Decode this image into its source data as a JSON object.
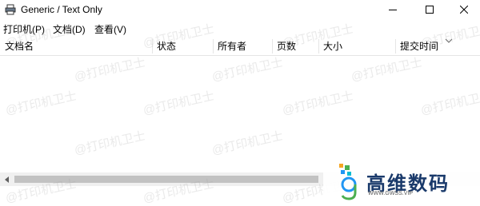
{
  "window": {
    "title": "Generic / Text Only"
  },
  "menu": {
    "items": [
      "打印机(P)",
      "文档(D)",
      "查看(V)"
    ]
  },
  "columns": [
    "文档名",
    "状态",
    "所有者",
    "页数",
    "大小",
    "提交时间"
  ],
  "watermark": {
    "text": "@打印机卫士"
  },
  "logo": {
    "title": "高维数码",
    "url": "WWW.GWSS.VIP"
  },
  "colors": {
    "logo_text": "#1a3a6b",
    "scroll_thumb": "#c2c2c2"
  }
}
